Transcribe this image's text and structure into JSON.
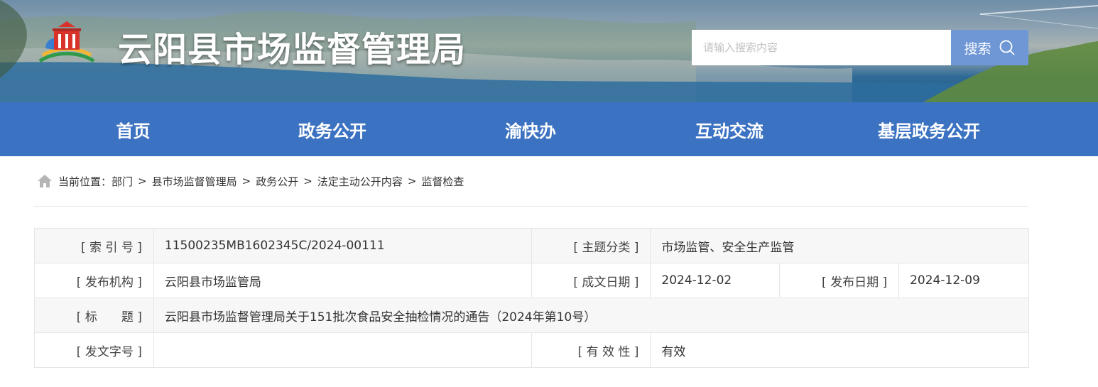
{
  "header": {
    "site_title": "云阳县市场监督管理局",
    "search_placeholder": "请输入搜索内容",
    "search_button": "搜索"
  },
  "nav": {
    "items": [
      {
        "label": "首页"
      },
      {
        "label": "政务公开"
      },
      {
        "label": "渝快办"
      },
      {
        "label": "互动交流"
      },
      {
        "label": "基层政务公开"
      }
    ]
  },
  "breadcrumb": {
    "prefix": "当前位置：",
    "items": [
      "部门",
      "县市场监督管理局",
      "政务公开",
      "法定主动公开内容",
      "监督检查"
    ],
    "separator": ">"
  },
  "info": {
    "index_label": "[ 索 引 号 ]",
    "index_value": "11500235MB1602345C/2024-00111",
    "topic_label": "[ 主题分类 ]",
    "topic_value": "市场监管、安全生产监管",
    "publisher_label": "[ 发布机构 ]",
    "publisher_value": "云阳县市场监管局",
    "written_date_label": "[ 成文日期 ]",
    "written_date_value": "2024-12-02",
    "publish_date_label": "[ 发布日期 ]",
    "publish_date_value": "2024-12-09",
    "title_label": "[ 标　　题 ]",
    "title_value": "云阳县市场监督管理局关于151批次食品安全抽检情况的通告（2024年第10号）",
    "doc_no_label": "[ 发文字号 ]",
    "doc_no_value": "",
    "validity_label": "[ 有 效 性 ]",
    "validity_value": "有效"
  },
  "colors": {
    "nav_bg": "#3c72c2",
    "search_btn_bg": "#6f97d6"
  },
  "icons": {
    "logo": "government-building-logo",
    "search": "search-icon",
    "home": "home-icon"
  }
}
